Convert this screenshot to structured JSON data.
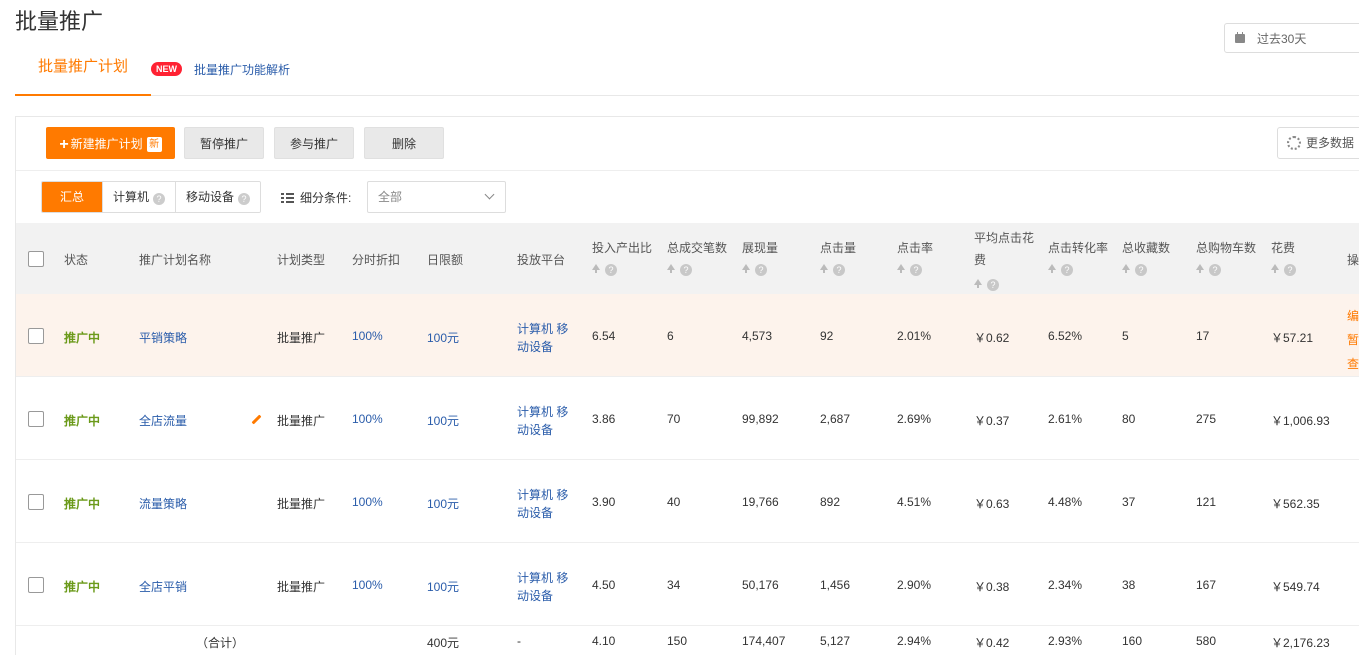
{
  "page": {
    "title": "批量推广"
  },
  "date_picker": {
    "value": "过去30天",
    "icon": "calendar-icon"
  },
  "tabs": {
    "active_label": "批量推广计划",
    "new_badge": "NEW",
    "feature_link": "批量推广功能解析"
  },
  "toolbar": {
    "new_plan": "新建推广计划",
    "new_plan_badge": "新",
    "pause": "暂停推广",
    "join": "参与推广",
    "delete": "删除",
    "more_data": "更多数据"
  },
  "segments": {
    "summary": "汇总",
    "computer": "计算机",
    "mobile": "移动设备",
    "help": "?"
  },
  "filter": {
    "label": "细分条件:",
    "value": "全部"
  },
  "table": {
    "headers": {
      "status": "状态",
      "name": "推广计划名称",
      "type": "计划类型",
      "discount": "分时折扣",
      "budget": "日限额",
      "platform": "投放平台",
      "roi": "投入产出比",
      "orders": "总成交笔数",
      "impressions": "展现量",
      "clicks": "点击量",
      "ctr": "点击率",
      "cpc": "平均点击花费",
      "cvr": "点击转化率",
      "favorites": "总收藏数",
      "cart": "总购物车数",
      "cost": "花费",
      "ops": "操"
    },
    "rows": [
      {
        "status": "推广中",
        "name": "平销策略",
        "type": "批量推广",
        "discount": "100%",
        "budget": "100元",
        "platform": "计算机 移动设备",
        "roi": "6.54",
        "orders": "6",
        "impressions": "4,573",
        "clicks": "92",
        "ctr": "2.01%",
        "cpc": "￥0.62",
        "cvr": "6.52%",
        "favorites": "5",
        "cart": "17",
        "cost": "￥57.21",
        "ops": [
          "编",
          "暂",
          "查"
        ]
      },
      {
        "status": "推广中",
        "name": "全店流量",
        "type": "批量推广",
        "discount": "100%",
        "budget": "100元",
        "platform": "计算机 移动设备",
        "roi": "3.86",
        "orders": "70",
        "impressions": "99,892",
        "clicks": "2,687",
        "ctr": "2.69%",
        "cpc": "￥0.37",
        "cvr": "2.61%",
        "favorites": "80",
        "cart": "275",
        "cost": "￥1,006.93"
      },
      {
        "status": "推广中",
        "name": "流量策略",
        "type": "批量推广",
        "discount": "100%",
        "budget": "100元",
        "platform": "计算机 移动设备",
        "roi": "3.90",
        "orders": "40",
        "impressions": "19,766",
        "clicks": "892",
        "ctr": "4.51%",
        "cpc": "￥0.63",
        "cvr": "4.48%",
        "favorites": "37",
        "cart": "121",
        "cost": "￥562.35"
      },
      {
        "status": "推广中",
        "name": "全店平销",
        "type": "批量推广",
        "discount": "100%",
        "budget": "100元",
        "platform": "计算机 移动设备",
        "roi": "4.50",
        "orders": "34",
        "impressions": "50,176",
        "clicks": "1,456",
        "ctr": "2.90%",
        "cpc": "￥0.38",
        "cvr": "2.34%",
        "favorites": "38",
        "cart": "167",
        "cost": "￥549.74"
      }
    ],
    "totals": {
      "label": "（合计）",
      "budget": "400元",
      "platform": "-",
      "roi": "4.10",
      "orders": "150",
      "impressions": "174,407",
      "clicks": "5,127",
      "ctr": "2.94%",
      "cpc": "￥0.42",
      "cvr": "2.93%",
      "favorites": "160",
      "cart": "580",
      "cost": "￥2,176.23"
    }
  },
  "colors": {
    "accent": "#ff7a00",
    "link": "#2a5caa",
    "status": "#6b9a1a",
    "highlight_row": "#fdf3ec"
  }
}
